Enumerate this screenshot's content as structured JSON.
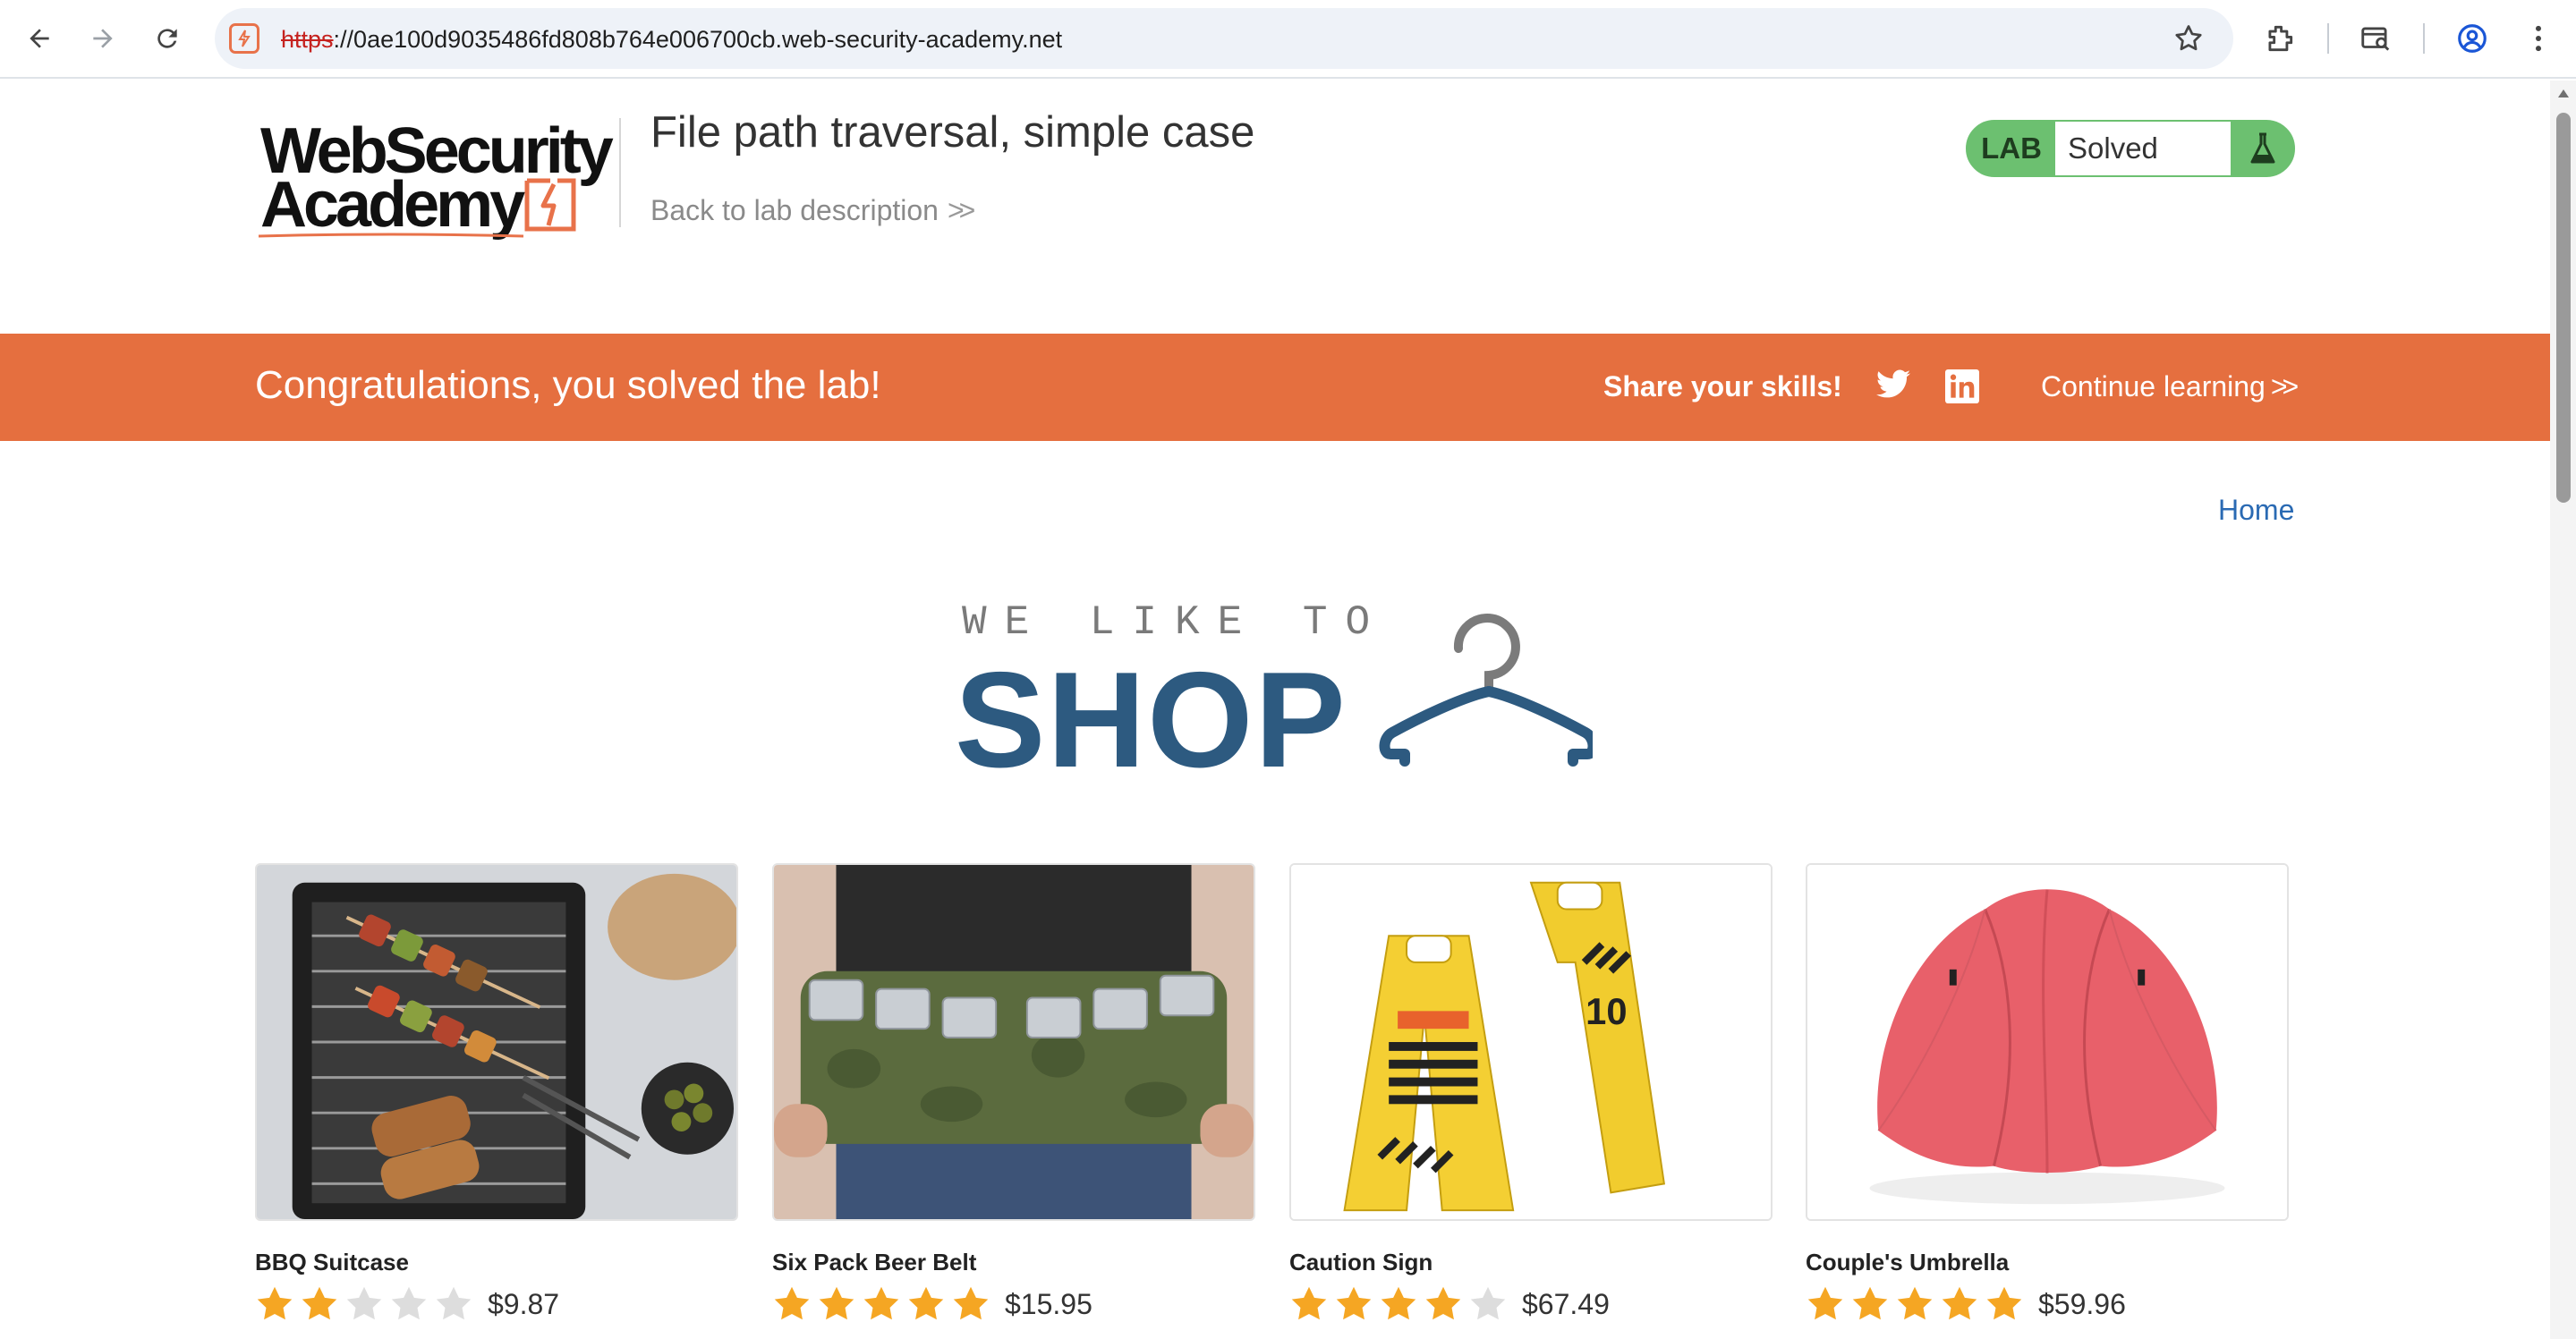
{
  "browser": {
    "url_scheme": "https",
    "url_rest": "://0ae100d9035486fd808b764e006700cb.web-security-academy.net"
  },
  "header": {
    "logo_line1": "WebSecurity",
    "logo_line2": "Academy",
    "lab_title": "File path traversal, simple case",
    "back_link": "Back to lab description",
    "lab_badge": "LAB",
    "lab_state": "Solved"
  },
  "banner": {
    "message": "Congratulations, you solved the lab!",
    "share": "Share your skills!",
    "continue": "Continue learning"
  },
  "shop": {
    "home_link": "Home",
    "tagline": "WE LIKE TO",
    "title": "SHOP"
  },
  "products": [
    {
      "name": "BBQ Suitcase",
      "price": "$9.87",
      "rating": 2
    },
    {
      "name": "Six Pack Beer Belt",
      "price": "$15.95",
      "rating": 5
    },
    {
      "name": "Caution Sign",
      "price": "$67.49",
      "rating": 4
    },
    {
      "name": "Couple's Umbrella",
      "price": "$59.96",
      "rating": 5
    }
  ],
  "colors": {
    "accent_orange": "#e56f3f",
    "lab_green": "#6cc070",
    "shop_blue": "#2d5a80",
    "link_blue": "#2a6ab3",
    "star_filled": "#f5a623",
    "star_empty": "#dddddd"
  }
}
